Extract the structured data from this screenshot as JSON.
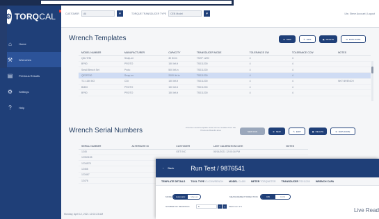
{
  "app": {
    "logo": {
      "brand": "TORQ",
      "suffix": "CAL",
      "flag": "TM"
    },
    "sidebar": {
      "items": [
        {
          "label": "Home",
          "icon": "home-icon"
        },
        {
          "label": "Wrenches",
          "icon": "wrench-icon",
          "active": true
        },
        {
          "label": "Previous Results",
          "icon": "results-icon"
        },
        {
          "label": "Settings",
          "icon": "gear-icon"
        },
        {
          "label": "Help",
          "icon": "help-icon"
        }
      ]
    },
    "topbar": {
      "customer_label": "CUSTOMER",
      "customer_value": "All",
      "transducer_label": "TORQUE TRANSDUCER TYPE",
      "transducer_value": "CEB Model",
      "user_text": "Lite, Steve Account  |  Logout"
    },
    "wrench_templates": {
      "title": "Wrench Templates",
      "buttons": [
        "NEW",
        "EDIT",
        "DELETE",
        "DUPLICATE"
      ],
      "columns": [
        "MODEL NUMBER",
        "MANUFACTURER",
        "CAPACITY",
        "TRANSDUCER MODE",
        "TOLERANCE CW",
        "TOLERANCE CCW",
        "NOTES"
      ],
      "rows": [
        [
          "QD-HHN",
          "Snap-on",
          "30 lbf-in",
          "TSXP 1200",
          "4",
          "4",
          ""
        ],
        [
          "BP50",
          "PROTO",
          "150 lbf-ft",
          "TS011200",
          "4",
          "4",
          ""
        ],
        [
          "Small Bench Set",
          "Proto",
          "500 lbf-in",
          "TS011200",
          "4",
          "4",
          ""
        ],
        [
          "QE2R700",
          "Snap-on",
          "2000 lbf-in",
          "TS011200",
          "4",
          "4",
          ""
        ],
        [
          "TC 1150 BO",
          "CDI",
          "150 lbf-ft",
          "TS011200",
          "4",
          "4",
          "NKT BRENCH"
        ],
        [
          "BM50",
          "PROTO",
          "150 lbf-ft",
          "TS011200",
          "4",
          "4",
          ""
        ],
        [
          "BP50",
          "PROTO",
          "150 lbf-ft",
          "TS011200",
          "4",
          "4",
          ""
        ]
      ],
      "selected_row": 3
    },
    "serial_numbers": {
      "title": "Wrench Serial Numbers",
      "hint": "Previous serial template tests can be recalled from the Previous Results area",
      "buttons": [
        "NEW RUN",
        "NEW",
        "EDIT",
        "DELETE",
        "DUPLICATE"
      ],
      "columns": [
        "SERIAL NUMBER",
        "ALTERNATE ID",
        "CUSTOMER",
        "LAST CALIBRATION DATE",
        "NOTES"
      ],
      "rows": [
        [
          "1245",
          "",
          "GET INC",
          "05/14/2021 12:00:16 PM",
          ""
        ],
        [
          "12353155",
          "",
          "",
          "",
          ""
        ],
        [
          "1234578",
          "",
          "",
          "",
          ""
        ],
        [
          "12466",
          "",
          "",
          "",
          ""
        ],
        [
          "123467",
          "",
          "",
          "",
          ""
        ],
        [
          "12476",
          "",
          "",
          "",
          ""
        ]
      ]
    },
    "status": {
      "text": "Monday, April 12, 2021 12:02:23 AM"
    }
  },
  "run_test": {
    "back_label": "Back",
    "title": "Run Test  /  9876541",
    "tabs": [
      {
        "label": "TEMPLATE DETAILS",
        "value": ""
      },
      {
        "label": "TOOL TYPE",
        "value": "CLICKWRENCH"
      },
      {
        "label": "MODEL",
        "value": "CL450"
      },
      {
        "label": "METER",
        "value": "TORQMETER"
      },
      {
        "label": "TRANSDUCER",
        "value": "TS011200"
      },
      {
        "label": "WRENCH CAPA",
        "value": ""
      }
    ],
    "mode_label": "MODE",
    "mode_options": [
      "Automatic",
      "Manual"
    ],
    "direction_label": "MEASUREMENT DIRECTION",
    "direction_options": [
      "CW",
      "CCW"
    ],
    "readings_label": "NUMBER OF READINGS",
    "readings_value": "5",
    "readings_note": "Maximum of 5",
    "live_label": "Live Read"
  },
  "colors": {
    "brand": "#1f3f78",
    "selected_row": "#cfdcf4",
    "logo_flag": "#e53935"
  }
}
